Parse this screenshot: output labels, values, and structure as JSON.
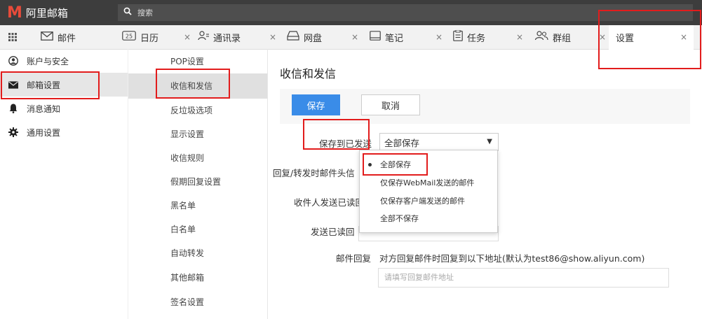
{
  "app": {
    "logo_letter": "M",
    "logo_text": "阿里邮箱"
  },
  "search": {
    "placeholder": "搜索",
    "icon": "search-icon"
  },
  "tabs": [
    {
      "label": "邮件",
      "icon": "envelope-icon"
    },
    {
      "label": "日历",
      "icon": "calendar-icon",
      "badge": "25"
    },
    {
      "label": "通讯录",
      "icon": "contacts-icon"
    },
    {
      "label": "网盘",
      "icon": "drive-icon"
    },
    {
      "label": "笔记",
      "icon": "note-icon"
    },
    {
      "label": "任务",
      "icon": "task-icon"
    },
    {
      "label": "群组",
      "icon": "group-icon"
    },
    {
      "label": "设置",
      "icon": "",
      "active": true
    }
  ],
  "grid_icon": "grid-icon",
  "close_glyph": "×",
  "sidebar": {
    "items": [
      {
        "label": "账户与安全",
        "icon": "account-icon"
      },
      {
        "label": "邮箱设置",
        "icon": "mail-icon",
        "active": true
      },
      {
        "label": "消息通知",
        "icon": "bell-icon"
      },
      {
        "label": "通用设置",
        "icon": "gear-icon"
      }
    ]
  },
  "subnav": {
    "items": [
      {
        "label": "POP设置"
      },
      {
        "label": "收信和发信",
        "active": true
      },
      {
        "label": "反垃圾选项"
      },
      {
        "label": "显示设置"
      },
      {
        "label": "收信规则"
      },
      {
        "label": "假期回复设置"
      },
      {
        "label": "黑名单"
      },
      {
        "label": "白名单"
      },
      {
        "label": "自动转发"
      },
      {
        "label": "其他邮箱"
      },
      {
        "label": "签名设置"
      }
    ]
  },
  "main": {
    "title": "收信和发信",
    "save_label": "保存",
    "cancel_label": "取消",
    "save_to_sent_label": "保存到已发送",
    "save_to_sent_value": "全部保存",
    "reply_forward_label": "回复/转发时邮件头信",
    "recipient_read_label": "收件人发送已读回",
    "send_read_label": "发送已读回",
    "mail_reply_label": "邮件回复",
    "mail_reply_desc": "对方回复邮件时回复到以下地址(默认为test86@show.aliyun.com)",
    "reply_placeholder": "请填写回复邮件地址"
  },
  "dropdown": {
    "options": [
      {
        "label": "全部保存",
        "selected": true
      },
      {
        "label": "仅保存WebMail发送的邮件"
      },
      {
        "label": "仅保存客户端发送的邮件"
      },
      {
        "label": "全部不保存"
      }
    ]
  },
  "colors": {
    "topbar": "#3d3d3d",
    "logo": "#e84b3a",
    "primary_button": "#3a8ce8",
    "highlight": "#e21c1c"
  }
}
